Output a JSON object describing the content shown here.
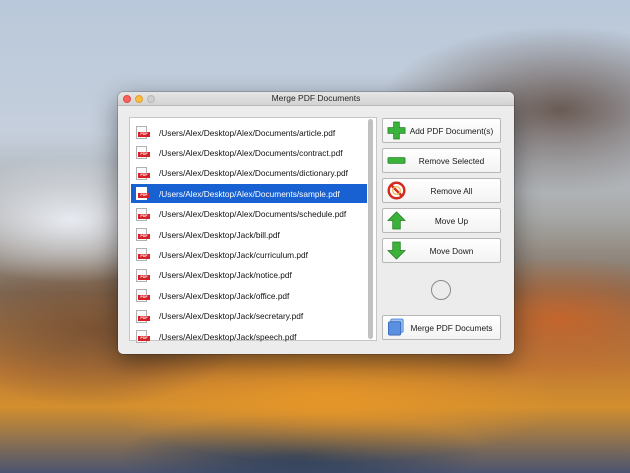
{
  "window": {
    "title": "Merge PDF Documents"
  },
  "file_list": {
    "icon_tag": "PDF",
    "selected_index": 3,
    "items": [
      "/Users/Alex/Desktop/Alex/Documents/article.pdf",
      "/Users/Alex/Desktop/Alex/Documents/contract.pdf",
      "/Users/Alex/Desktop/Alex/Documents/dictionary.pdf",
      "/Users/Alex/Desktop/Alex/Documents/sample.pdf",
      "/Users/Alex/Desktop/Alex/Documents/schedule.pdf",
      "/Users/Alex/Desktop/Jack/bill.pdf",
      "/Users/Alex/Desktop/Jack/curriculum.pdf",
      "/Users/Alex/Desktop/Jack/notice.pdf",
      "/Users/Alex/Desktop/Jack/office.pdf",
      "/Users/Alex/Desktop/Jack/secretary.pdf",
      "/Users/Alex/Desktop/Jack/speech.pdf"
    ]
  },
  "buttons": {
    "add": "Add PDF Document(s)",
    "remove_selected": "Remove Selected",
    "remove_all": "Remove All",
    "move_up": "Move Up",
    "move_down": "Move Down",
    "merge": "Merge PDF Documets"
  },
  "icons": {
    "add": "plus-icon",
    "remove_selected": "minus-icon",
    "remove_all": "prohibited-icon",
    "move_up": "arrow-up-icon",
    "move_down": "arrow-down-icon",
    "merge": "document-stack-icon"
  },
  "colors": {
    "selection": "#1761d2",
    "pdf_tag": "#d81f26",
    "icon_green": "#3bb33b",
    "icon_red": "#d42a1f",
    "icon_blue": "#3c78d8"
  }
}
